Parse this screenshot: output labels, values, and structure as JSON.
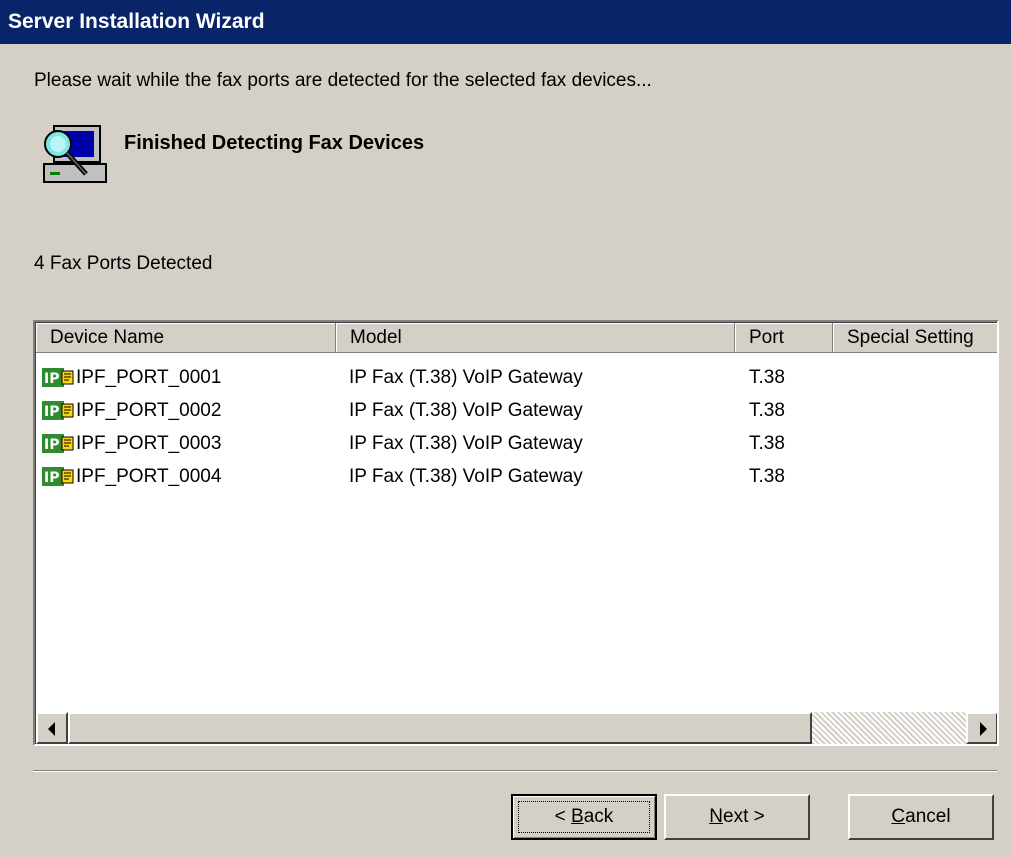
{
  "window": {
    "title": "Server Installation Wizard"
  },
  "status_message": "Please wait while the fax ports are detected for the selected fax devices...",
  "heading": "Finished Detecting Fax Devices",
  "ports_detected_label": "4 Fax Ports Detected",
  "table": {
    "columns": [
      "Device Name",
      "Model",
      "Port",
      "Special Setting"
    ],
    "rows": [
      {
        "device_name": "IPF_PORT_0001",
        "model": "IP Fax (T.38) VoIP Gateway",
        "port": "T.38",
        "special_setting": "",
        "icon": "ip-fax-icon"
      },
      {
        "device_name": "IPF_PORT_0002",
        "model": "IP Fax (T.38) VoIP Gateway",
        "port": "T.38",
        "special_setting": "",
        "icon": "ip-fax-icon"
      },
      {
        "device_name": "IPF_PORT_0003",
        "model": "IP Fax (T.38) VoIP Gateway",
        "port": "T.38",
        "special_setting": "",
        "icon": "ip-fax-icon"
      },
      {
        "device_name": "IPF_PORT_0004",
        "model": "IP Fax (T.38) VoIP Gateway",
        "port": "T.38",
        "special_setting": "",
        "icon": "ip-fax-icon"
      }
    ]
  },
  "buttons": {
    "back": {
      "accel": "B",
      "rest": "ack",
      "prefix": "< "
    },
    "next": {
      "accel": "N",
      "rest": "ext >"
    },
    "cancel": {
      "accel": "C",
      "rest": "ancel"
    }
  },
  "icons": {
    "header_icon": "computer-search-icon",
    "scroll_left": "arrow-left-icon",
    "scroll_right": "arrow-right-icon"
  },
  "colors": {
    "title_bar": "#0a246a",
    "dialog_bg": "#d4d0c8",
    "ip_icon_green": "#2e8b2e"
  }
}
